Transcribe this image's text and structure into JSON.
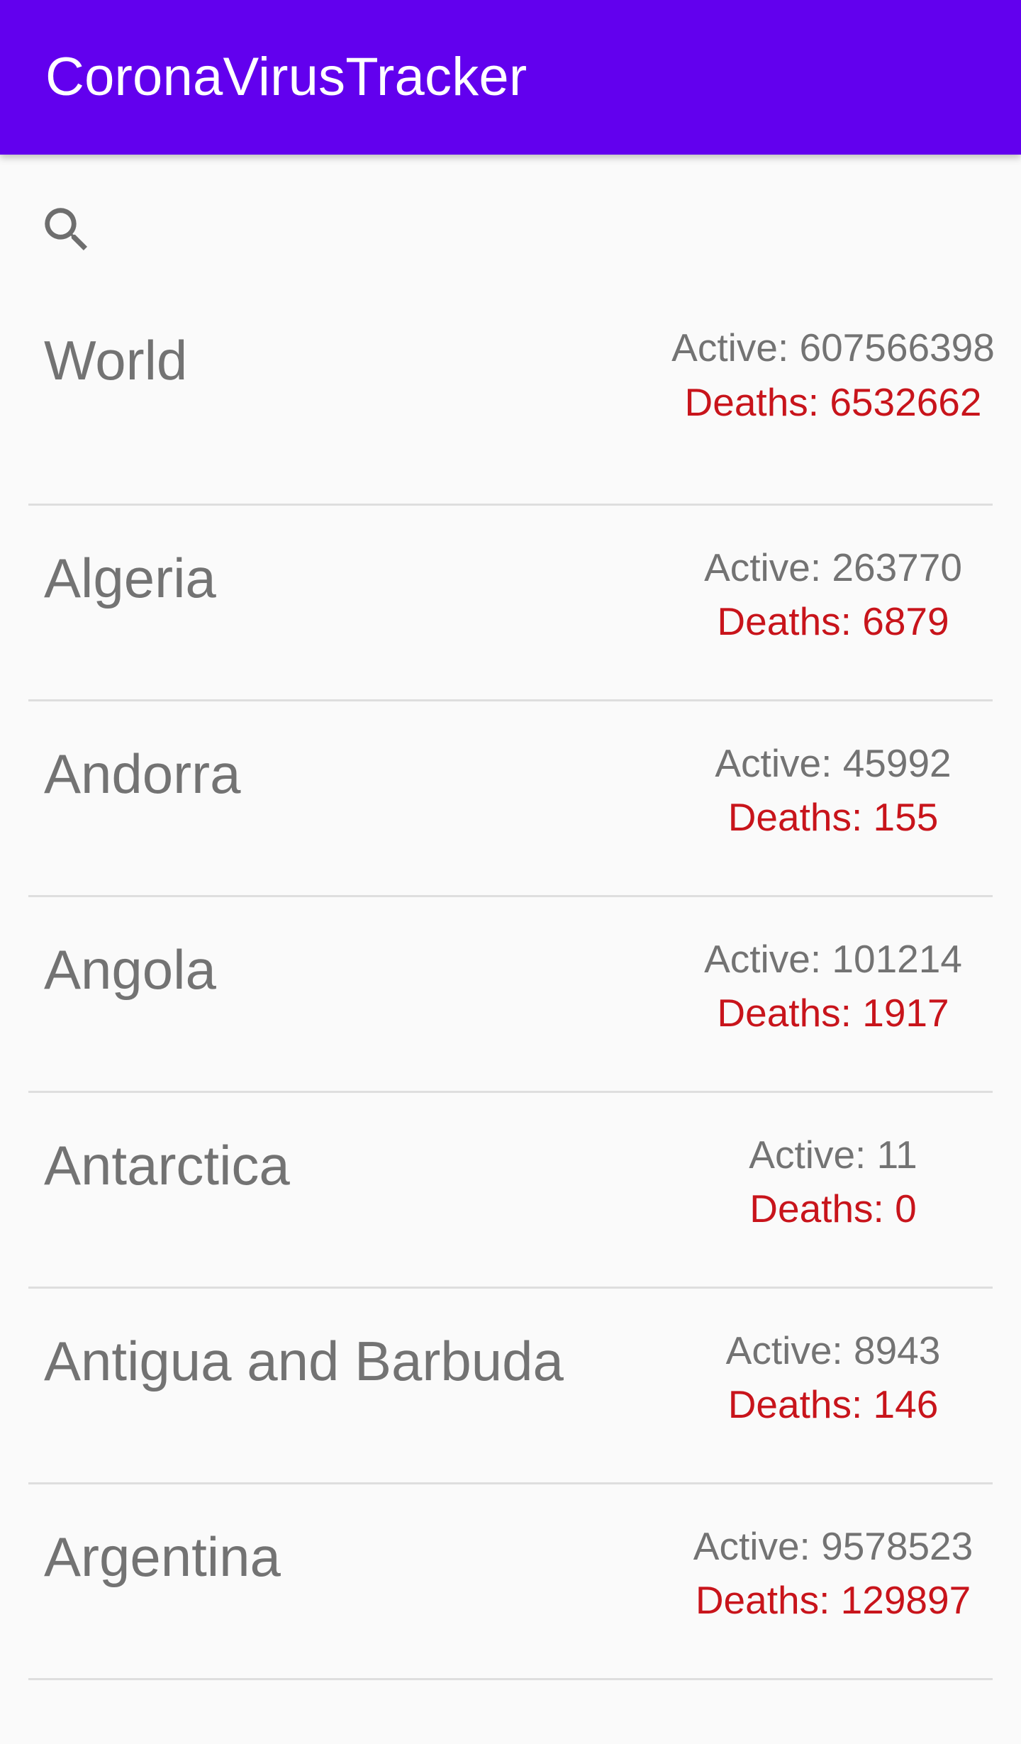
{
  "app_bar": {
    "title": "CoronaVirusTracker",
    "background": "#6200ee"
  },
  "search": {
    "icon": "search-icon"
  },
  "colors": {
    "country_text": "#737373",
    "active_text": "#737373",
    "deaths_text": "#c8141b",
    "background": "#fafafa"
  },
  "countries": [
    {
      "name": "World",
      "active": "Active: 607566398",
      "deaths": "Deaths: 6532662"
    },
    {
      "name": "Algeria",
      "active": "Active: 263770",
      "deaths": "Deaths: 6879"
    },
    {
      "name": "Andorra",
      "active": "Active: 45992",
      "deaths": "Deaths: 155"
    },
    {
      "name": "Angola",
      "active": "Active: 101214",
      "deaths": "Deaths: 1917"
    },
    {
      "name": "Antarctica",
      "active": "Active: 11",
      "deaths": "Deaths: 0"
    },
    {
      "name": "Antigua and Barbuda",
      "active": "Active: 8943",
      "deaths": "Deaths: 146"
    },
    {
      "name": "Argentina",
      "active": "Active: 9578523",
      "deaths": "Deaths: 129897"
    }
  ]
}
